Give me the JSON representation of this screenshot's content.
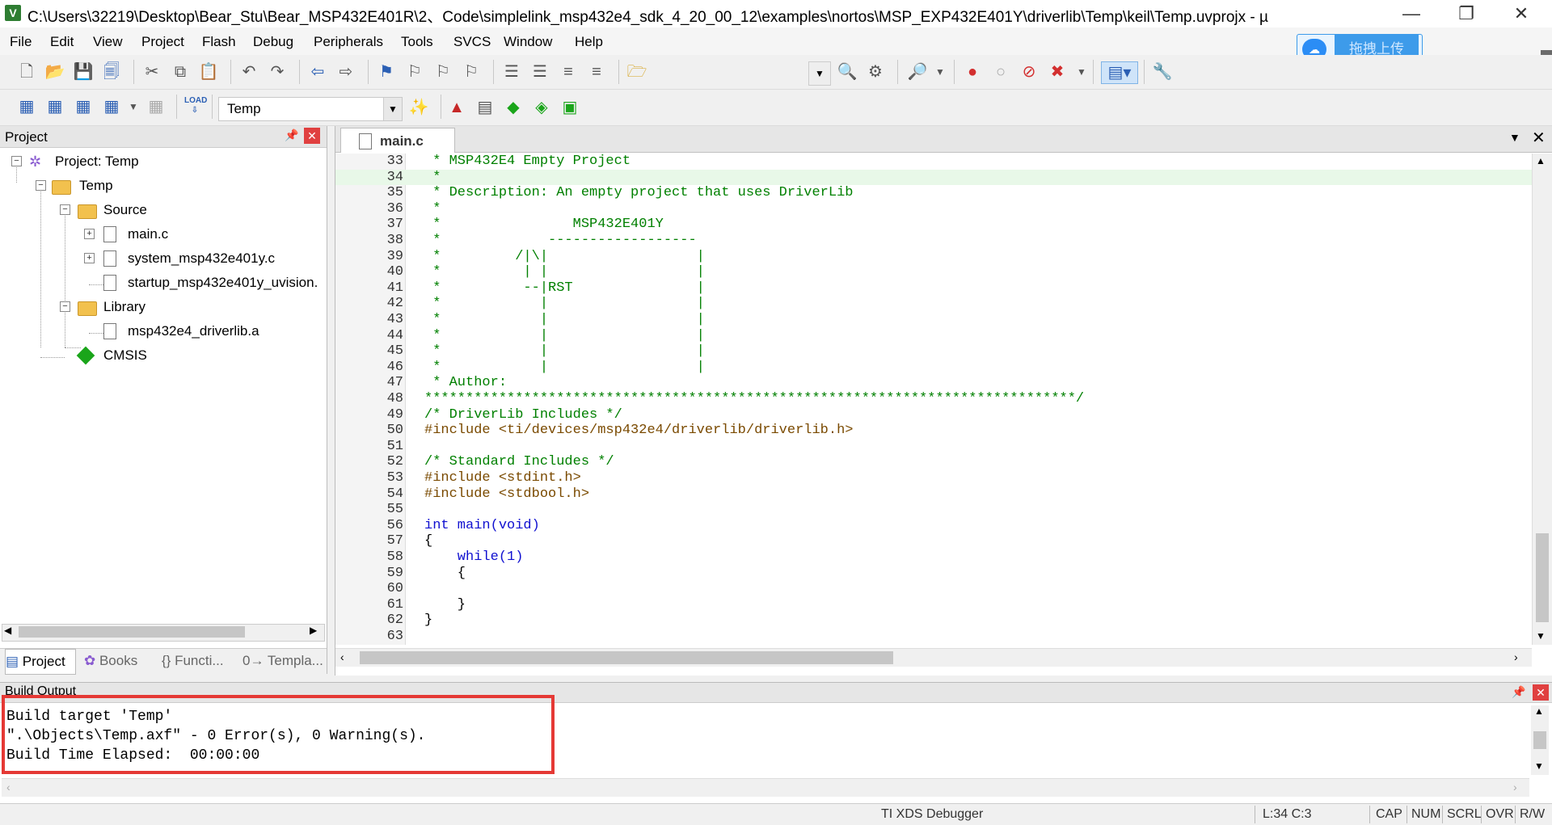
{
  "window": {
    "title": "C:\\Users\\32219\\Desktop\\Bear_Stu\\Bear_MSP432E401R\\2、Code\\simplelink_msp432e4_sdk_4_20_00_12\\examples\\nortos\\MSP_EXP432E401Y\\driverlib\\Temp\\keil\\Temp.uvprojx - µ",
    "app_icon": "V",
    "minimize": "—",
    "restore": "❐",
    "close": "✕"
  },
  "menu": [
    "File",
    "Edit",
    "View",
    "Project",
    "Flash",
    "Debug",
    "Peripherals",
    "Tools",
    "SVCS",
    "Window",
    "Help"
  ],
  "upload": {
    "label": "拖拽上传",
    "icon": "cloud-icon"
  },
  "toolbar2": {
    "target": "Temp"
  },
  "project_panel": {
    "title": "Project",
    "tree": {
      "root": "Project: Temp",
      "target": "Temp",
      "source_group": "Source",
      "source_files": [
        "main.c",
        "system_msp432e401y.c",
        "startup_msp432e401y_uvision."
      ],
      "library_group": "Library",
      "library_files": [
        "msp432e4_driverlib.a"
      ],
      "cmsis": "CMSIS"
    },
    "tabs": [
      "Project",
      "Books",
      "{} Functi...",
      "0→ Templa..."
    ]
  },
  "editor": {
    "tab": "main.c",
    "lines": [
      {
        "n": "33",
        "t": " * MSP432E4 Empty Project",
        "c": "cmt"
      },
      {
        "n": "34",
        "t": " *",
        "c": "cmt",
        "hl": true
      },
      {
        "n": "35",
        "t": " * Description: An empty project that uses DriverLib",
        "c": "cmt"
      },
      {
        "n": "36",
        "t": " *",
        "c": "cmt"
      },
      {
        "n": "37",
        "t": " *                MSP432E401Y",
        "c": "cmt"
      },
      {
        "n": "38",
        "t": " *             ------------------",
        "c": "cmt"
      },
      {
        "n": "39",
        "t": " *         /|\\|                  |",
        "c": "cmt"
      },
      {
        "n": "40",
        "t": " *          | |                  |",
        "c": "cmt"
      },
      {
        "n": "41",
        "t": " *          --|RST               |",
        "c": "cmt"
      },
      {
        "n": "42",
        "t": " *            |                  |",
        "c": "cmt"
      },
      {
        "n": "43",
        "t": " *            |                  |",
        "c": "cmt"
      },
      {
        "n": "44",
        "t": " *            |                  |",
        "c": "cmt"
      },
      {
        "n": "45",
        "t": " *            |                  |",
        "c": "cmt"
      },
      {
        "n": "46",
        "t": " *            |                  |",
        "c": "cmt"
      },
      {
        "n": "47",
        "t": " * Author:",
        "c": "cmt"
      },
      {
        "n": "48",
        "t": "*******************************************************************************/",
        "c": "cmt"
      },
      {
        "n": "49",
        "t": "/* DriverLib Includes */",
        "c": "cmt"
      },
      {
        "n": "50",
        "t": "#include <ti/devices/msp432e4/driverlib/driverlib.h>",
        "c": "pp"
      },
      {
        "n": "51",
        "t": "",
        "c": ""
      },
      {
        "n": "52",
        "t": "/* Standard Includes */",
        "c": "cmt"
      },
      {
        "n": "53",
        "t": "#include <stdint.h>",
        "c": "pp"
      },
      {
        "n": "54",
        "t": "#include <stdbool.h>",
        "c": "pp"
      },
      {
        "n": "55",
        "t": "",
        "c": ""
      },
      {
        "n": "56",
        "t": "int main(void)",
        "c": "kw"
      },
      {
        "n": "57",
        "t": "{",
        "c": ""
      },
      {
        "n": "58",
        "t": "    while(1)",
        "c": "kw"
      },
      {
        "n": "59",
        "t": "    {",
        "c": ""
      },
      {
        "n": "60",
        "t": "",
        "c": ""
      },
      {
        "n": "61",
        "t": "    }",
        "c": ""
      },
      {
        "n": "62",
        "t": "}",
        "c": ""
      },
      {
        "n": "63",
        "t": "",
        "c": ""
      }
    ]
  },
  "build_output": {
    "title": "Build Output",
    "lines": [
      "Build target 'Temp'",
      "\".\\Objects\\Temp.axf\" - 0 Error(s), 0 Warning(s).",
      "Build Time Elapsed:  00:00:00"
    ]
  },
  "status": {
    "debugger": "TI XDS Debugger",
    "position": "L:34 C:3",
    "cap": "CAP",
    "num": "NUM",
    "scrl": "SCRL",
    "ovr": "OVR",
    "rw": "R/W"
  },
  "colors": {
    "comment": "#008000",
    "keyword": "#1010d0",
    "highlight_box": "#e53935",
    "upload": "#3d9bea"
  }
}
